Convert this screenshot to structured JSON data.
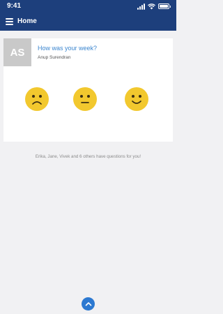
{
  "status": {
    "time": "9:41"
  },
  "nav": {
    "title": "Home"
  },
  "card": {
    "avatar_initials": "AS",
    "question": "How was your week?",
    "author": "Anup Surendran",
    "faces": [
      {
        "icon": "frown-face-icon"
      },
      {
        "icon": "neutral-face-icon"
      },
      {
        "icon": "smile-face-icon"
      }
    ]
  },
  "note": "Erika, Jane, Vivek and 6 others have questions for you!",
  "colors": {
    "header": "#1d3f7c",
    "accent": "#3b86cf",
    "face": "#f2c82e"
  }
}
